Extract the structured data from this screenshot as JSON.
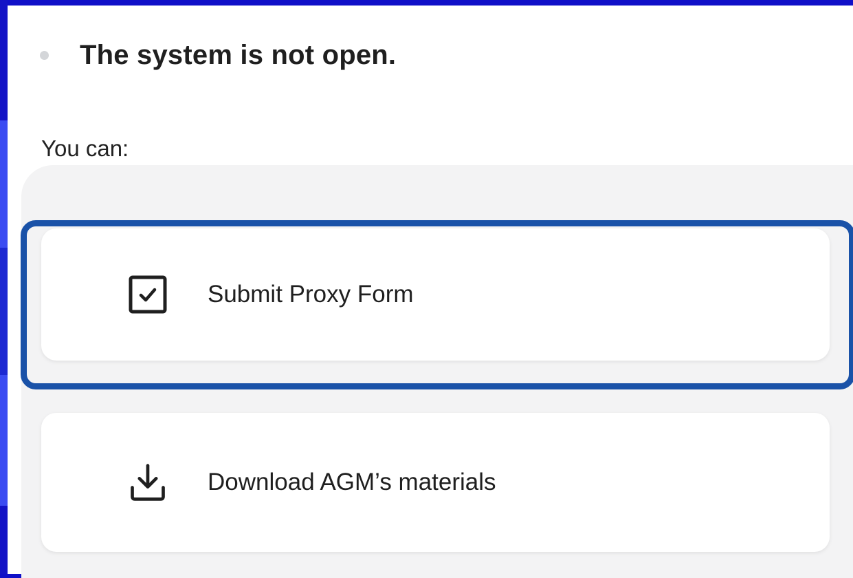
{
  "status": {
    "text": "The system is not open."
  },
  "intro": {
    "label": "You can:"
  },
  "options": [
    {
      "label": "Submit Proxy Form",
      "icon": "checkbox-checked-icon"
    },
    {
      "label": "Download AGM’s materials",
      "icon": "download-icon"
    }
  ],
  "colors": {
    "background_frame": "#1010c8",
    "highlight_border": "#1a52a8",
    "status_dot": "#d4d6d9"
  }
}
